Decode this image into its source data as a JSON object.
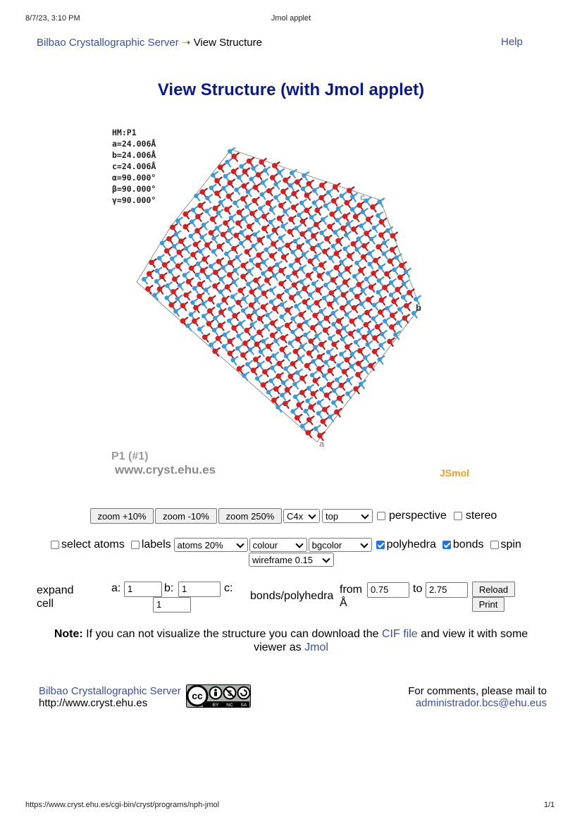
{
  "print_header": {
    "datetime": "8/7/23, 3:10 PM",
    "title": "Jmol applet"
  },
  "breadcrumb": {
    "home": "Bilbao Crystallographic Server",
    "arrow": "➝",
    "current": "View Structure",
    "help": "Help"
  },
  "page_title": "View Structure (with Jmol applet)",
  "viewer": {
    "hm_lines": [
      "HM:P1",
      "a=24.006Å",
      "b=24.006Å",
      "c=24.006Å",
      "α=90.000°",
      "β=90.000°",
      "γ=90.000°"
    ],
    "spacegroup": "P1 (#1)",
    "site": "www.cryst.ehu.es",
    "brand": "JSmol",
    "axis_a": "a",
    "axis_b": "b",
    "axis_c": "c",
    "colors": {
      "oxygen": "#d81e1e",
      "silicon": "#3a9ad9",
      "brand": "#f0a020"
    }
  },
  "controls_row1": {
    "zoom_in": "zoom +10%",
    "zoom_out": "zoom -10%",
    "zoom_250": "zoom 250%",
    "axis_select": "C4x",
    "view_select": "top",
    "perspective": "perspective",
    "perspective_checked": false,
    "stereo": "stereo",
    "stereo_checked": false
  },
  "controls_row2": {
    "select_atoms": "select atoms",
    "labels": "labels",
    "atoms_select": "atoms 20%",
    "colour_select": "colour",
    "bgcolor_select": "bgcolor",
    "polyhedra": "polyhedra",
    "polyhedra_checked": true,
    "bonds": "bonds",
    "bonds_checked": true,
    "spin": "spin",
    "spin_checked": false,
    "wireframe_select": "wireframe 0.15"
  },
  "expand": {
    "label_line1": "expand",
    "label_line2": "cell",
    "a_label": "a:",
    "a_value": "1",
    "b_label": "b:",
    "b_value": "1",
    "c_label": "c:",
    "c_value": "1",
    "bonds_label": "bonds/polyhedra",
    "from_label": "from",
    "from_value": "0.75",
    "unit": "Å",
    "to_label": "to",
    "to_value": "2.75",
    "reload": "Reload",
    "print": "Print"
  },
  "note": {
    "bold": "Note:",
    "text1": "If you can not visualize the structure you can download the",
    "cif_link": "CIF file",
    "text2": "and view it with some",
    "text3": "viewer as",
    "jmol_link": "Jmol"
  },
  "footer": {
    "server_link": "Bilbao Crystallographic Server",
    "url": "http://www.cryst.ehu.es",
    "license_by": "BY",
    "license_nc": "NC",
    "license_sa": "SA",
    "comments": "For comments, please mail to",
    "email": "administrador.bcs@ehu.eus"
  },
  "print_footer": {
    "url": "https://www.cryst.ehu.es/cgi-bin/cryst/programs/nph-jmol",
    "page": "1/1"
  }
}
